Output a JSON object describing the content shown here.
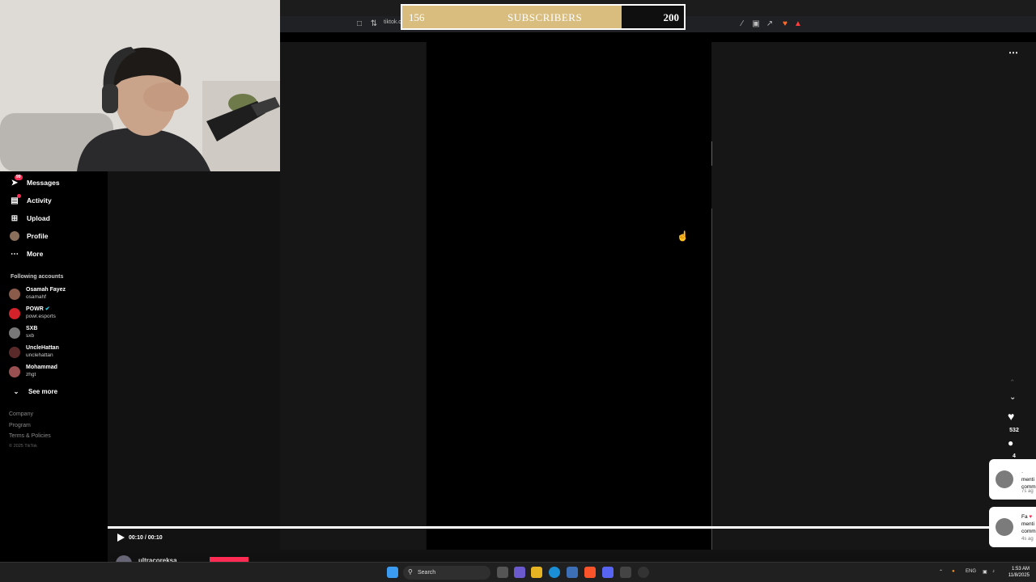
{
  "browser": {
    "url": "tiktok.c"
  },
  "subscriber_goal": {
    "current": "156",
    "label": "SUBSCRIBERS",
    "goal": "200",
    "progress": 0.78
  },
  "sidebar": {
    "messages_badge": "99",
    "items": [
      {
        "label": "Messages",
        "icon": "send-icon"
      },
      {
        "label": "Activity",
        "icon": "inbox-icon"
      },
      {
        "label": "Upload",
        "icon": "plus-square-icon"
      },
      {
        "label": "Profile",
        "icon": "avatar"
      },
      {
        "label": "More",
        "icon": "more-icon"
      }
    ],
    "following_title": "Following accounts",
    "accounts": [
      {
        "name": "Osamah Fayez",
        "handle": "osamahf",
        "color": "#8a5a4a"
      },
      {
        "name": "POWR",
        "handle": "powr.esports",
        "color": "#d4222a",
        "verified": true
      },
      {
        "name": "SXB",
        "handle": "sxb",
        "color": "#777777"
      },
      {
        "name": "UncleHattan",
        "handle": "unclehattan",
        "color": "#5a2a2a"
      },
      {
        "name": "Mohammad",
        "handle": "zhgt",
        "color": "#9a5050"
      }
    ],
    "see_more": "See more",
    "footer": {
      "company": "Company",
      "program": "Program",
      "terms": "Terms & Policies",
      "copyright": "© 2025 TikTok"
    }
  },
  "video": {
    "time": "00:10 / 00:10",
    "progress": 1.0,
    "username": "ultracoreksa"
  },
  "actions": {
    "likes": "532",
    "comments": "4"
  },
  "notifications": [
    {
      "line1": "·",
      "line2": "menti",
      "line3": "comm",
      "time": "7s ag"
    },
    {
      "line1": "Fa",
      "line2": "menti",
      "line3": "comm",
      "time": "4s ag"
    }
  ],
  "taskbar": {
    "search_placeholder": "Search",
    "lang": "ENG",
    "time": "1:53 AM",
    "date": "11/8/2025"
  },
  "colors": {
    "accent": "#fe2c55",
    "goal_fill": "#d9bd7e",
    "background": "#121212"
  }
}
